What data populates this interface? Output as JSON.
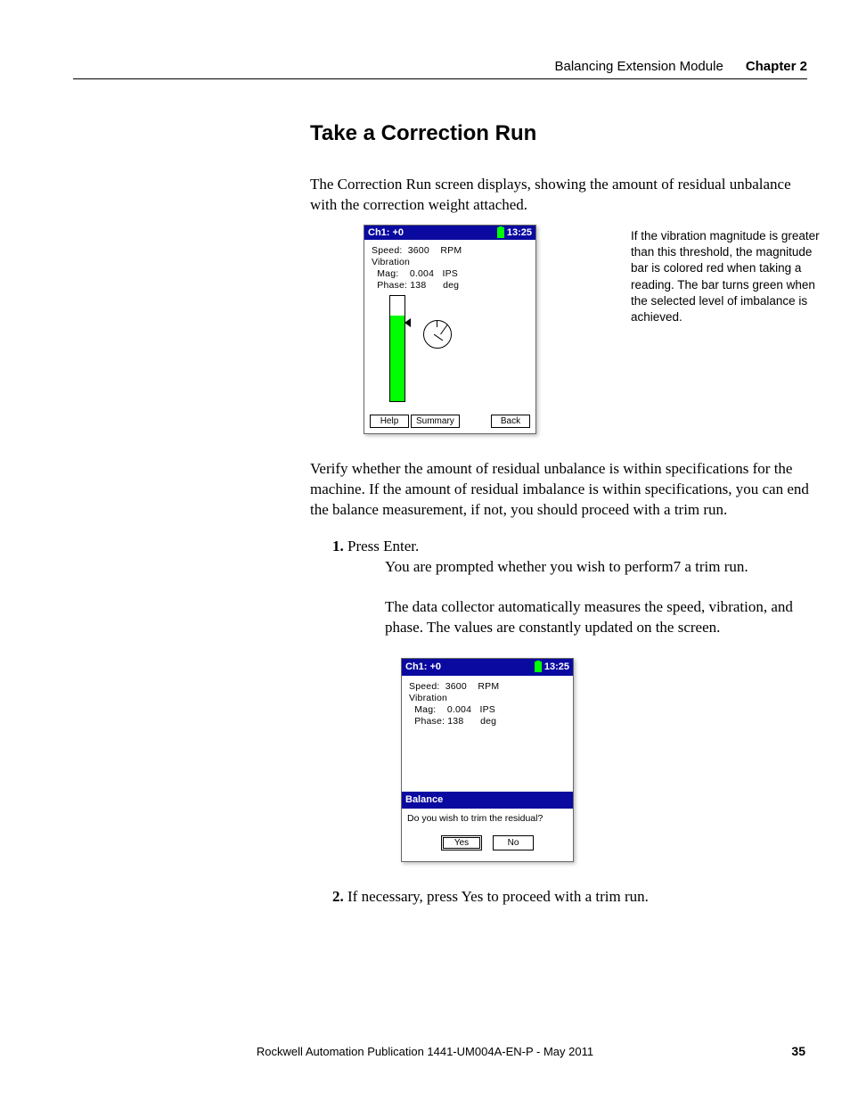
{
  "header": {
    "section_title": "Balancing Extension Module",
    "chapter_label": "Chapter 2"
  },
  "heading": "Take a Correction Run",
  "para1": "The Correction Run screen displays, showing the amount of residual unbalance with the correction weight attached.",
  "device1": {
    "title_left": "Ch1: +0",
    "time": "13:25",
    "readouts": {
      "l1": "Speed:  3600    RPM",
      "l2": "Vibration",
      "l3": "  Mag:    0.004   IPS",
      "l4": "  Phase: 138      deg"
    },
    "buttons": {
      "help": "Help",
      "summary": "Summary",
      "back": "Back"
    }
  },
  "callout": "If the vibration magnitude is greater than this threshold, the magnitude bar is colored red when taking a reading. The bar turns green when the selected level of imbalance is achieved.",
  "para2": "Verify whether the amount of residual unbalance is within specifications for the machine. If the amount of residual imbalance is within specifications, you can end the balance measurement, if not, you should proceed with a trim run.",
  "step1": {
    "text": "Press Enter.",
    "sub1": "You are prompted whether you wish to perform7 a trim run.",
    "sub2": "The data collector automatically measures the speed, vibration, and phase. The values are constantly updated on the screen."
  },
  "device2": {
    "title_left": "Ch1: +0",
    "time": "13:25",
    "readouts": {
      "l1": "Speed:  3600    RPM",
      "l2": "Vibration",
      "l3": "  Mag:    0.004   IPS",
      "l4": "  Phase: 138      deg"
    },
    "dialog": {
      "title": "Balance",
      "question": "Do you wish to trim the residual?",
      "yes": "Yes",
      "no": "No"
    }
  },
  "step2": "If necessary, press Yes to proceed with a trim run.",
  "footer": {
    "pub": "Rockwell Automation Publication 1441-UM004A-EN-P - May 2011",
    "page": "35"
  }
}
